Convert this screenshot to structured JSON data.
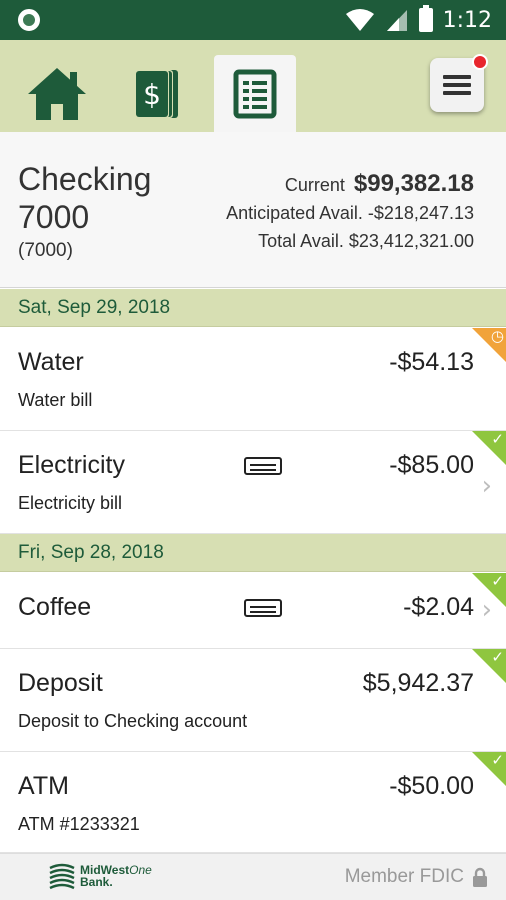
{
  "status_bar": {
    "time": "1:12"
  },
  "nav": {
    "tabs": [
      {
        "name": "home",
        "icon": "home-icon"
      },
      {
        "name": "accounts",
        "icon": "dollar-bill-icon"
      },
      {
        "name": "register",
        "icon": "register-list-icon",
        "active": true
      }
    ],
    "menu_icon": "hamburger-menu-icon",
    "menu_has_notification": true
  },
  "account": {
    "name": "Checking 7000",
    "number": "(7000)",
    "current_label": "Current",
    "current_value": "$99,382.18",
    "anticipated_line": "Anticipated Avail. -$218,247.13",
    "total_line": "Total Avail. $23,412,321.00"
  },
  "groups": [
    {
      "date": "Sat, Sep 29, 2018",
      "transactions": [
        {
          "title": "Water",
          "amount": "-$54.13",
          "description": "Water bill",
          "status": "pending"
        },
        {
          "title": "Electricity",
          "amount": "-$85.00",
          "description": "Electricity bill",
          "status": "cleared",
          "card": true,
          "chevron": true
        }
      ]
    },
    {
      "date": "Fri, Sep 28, 2018",
      "transactions": [
        {
          "title": "Coffee",
          "amount": "-$2.04",
          "description": "",
          "status": "cleared",
          "card": true,
          "chevron": true
        },
        {
          "title": "Deposit",
          "amount": "$5,942.37",
          "description": "Deposit to Checking account",
          "status": "cleared"
        },
        {
          "title": "ATM",
          "amount": "-$50.00",
          "description": "ATM #1233321",
          "status": "cleared"
        }
      ]
    }
  ],
  "footer": {
    "logo_line1": "MidWest",
    "logo_line1_italic": "One",
    "logo_line2": "Bank.",
    "fdic_text": "Member FDIC"
  },
  "colors": {
    "brand_green": "#1e5b3a",
    "nav_bg": "#d7dfb3",
    "cleared_green": "#8fc63f",
    "pending_orange": "#f1a33a",
    "notification_red": "#e8262d"
  }
}
